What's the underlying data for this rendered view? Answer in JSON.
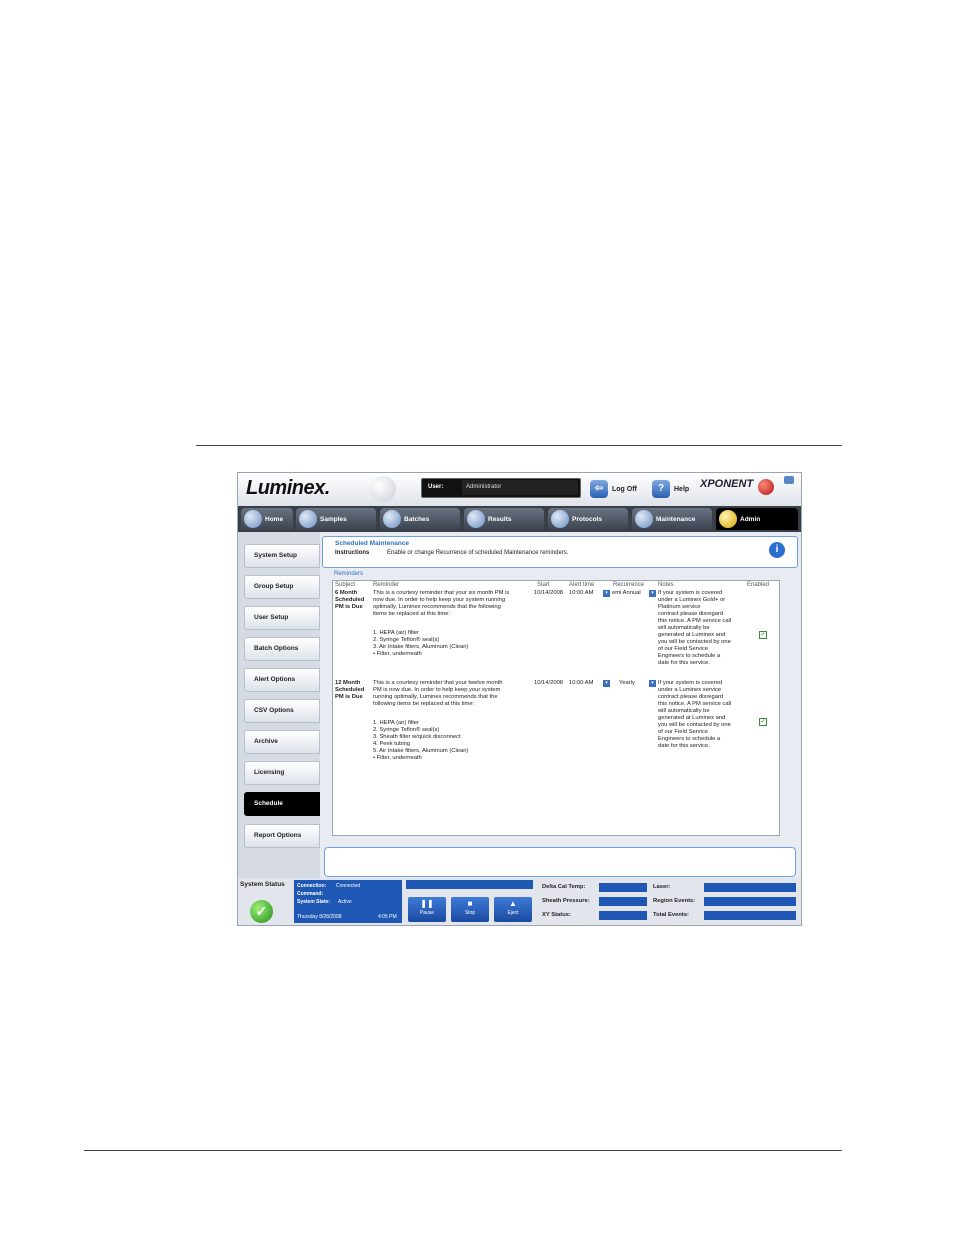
{
  "app": {
    "logo": "Luminex.",
    "brand": "XPONENT",
    "user_label": "User:",
    "user_value": "Administrator",
    "logoff_label": "Log Off",
    "help_label": "Help"
  },
  "nav": {
    "tabs": [
      {
        "label": "Home"
      },
      {
        "label": "Samples"
      },
      {
        "label": "Batches"
      },
      {
        "label": "Results"
      },
      {
        "label": "Protocols"
      },
      {
        "label": "Maintenance"
      },
      {
        "label": "Admin"
      }
    ],
    "active": "Admin"
  },
  "sidebar": {
    "items": [
      {
        "label": "System Setup"
      },
      {
        "label": "Group Setup"
      },
      {
        "label": "User Setup"
      },
      {
        "label": "Batch Options"
      },
      {
        "label": "Alert Options"
      },
      {
        "label": "CSV Options"
      },
      {
        "label": "Archive"
      },
      {
        "label": "Licensing"
      },
      {
        "label": "Schedule"
      },
      {
        "label": "Report Options"
      }
    ],
    "active": "Schedule"
  },
  "main": {
    "title": "Scheduled Maintenance",
    "instructions_label": "Instructions",
    "instructions_text": "Enable or change Recurrence of scheduled Maintenance reminders.",
    "reminders_label": "Reminders",
    "columns": [
      "Subject",
      "Reminder",
      "Start",
      "Alert time",
      "Recurrence",
      "Notes",
      "Enabled"
    ],
    "rows": [
      {
        "subject": [
          "6 Month",
          "Scheduled",
          "PM is Due"
        ],
        "reminder": [
          "This is a courtesy reminder that your six month PM is",
          "now due. In order to help keep your system running",
          "optimally, Luminex recommends that the following",
          "items be replaced at this time:",
          "",
          "1.     HEPA (air) filter",
          "2.     Syringe Teflon® seal(s)",
          "3.     Air Intake filters, Aluminum (Clean)",
          "          • Filter, underneath"
        ],
        "start": "10/14/2008",
        "alert_time": "10:00 AM",
        "recurrence": "emi Annual",
        "notes": [
          "If your system is covered",
          "under a Luminex Gold+ or",
          "Platinum service",
          "contract please disregard",
          "this notice. A PM service call",
          "will automatically be",
          "generated at Luminex and",
          "you will be contacted by one",
          "of our Field Service",
          "Engineers to schedule a",
          "date for this service."
        ],
        "enabled": "✓"
      },
      {
        "subject": [
          "12 Month",
          "Scheduled",
          "PM is Due"
        ],
        "reminder": [
          "This is a courtesy reminder that your twelve month",
          "PM is now due. In order to help keep your system",
          "running optimally, Luminex recommends that the",
          "following items be replaced at this time:",
          "",
          "1.     HEPA (air) filter",
          "2.     Syringe Teflon® seal(s)",
          "3.     Sheath filter w/quick disconnect",
          "4.     Peek tubing",
          "5.     Air Intake filters, Aluminum (Clean)",
          "          • Filter, underneath"
        ],
        "start": "10/14/2008",
        "alert_time": "10:00 AM",
        "recurrence": "Yearly",
        "notes": [
          "If your system is covered",
          "under a Luminex service",
          "contract please disregard",
          "this notice. A PM service call",
          "will automatically be",
          "generated at Luminex and",
          "you will be contacted by one",
          "of our Field Service",
          "Engineers to schedule a",
          "date for this service."
        ],
        "enabled": "✓"
      }
    ]
  },
  "status": {
    "system_status_label": "System Status",
    "connection_label": "Connection:",
    "connection_value": "Connected",
    "command_label": "Command:",
    "system_state_label": "System State:",
    "system_state_value": "Active",
    "date": "Thursday 8/28/2008",
    "time": "4:05 PM",
    "pause_label": "Pause",
    "stop_label": "Stop",
    "eject_label": "Eject",
    "delta_cal_temp_label": "Delta Cal Temp:",
    "sheath_pressure_label": "Sheath Pressure:",
    "xy_status_label": "XY Status:",
    "laser_label": "Laser:",
    "region_events_label": "Region Events:",
    "total_events_label": "Total Events:"
  },
  "icons": {
    "logoff": "logoff-icon",
    "help": "help-icon",
    "info": "info-icon",
    "status_ok": "checkmark-icon",
    "pause": "pause-icon",
    "stop": "stop-icon",
    "eject": "eject-icon"
  }
}
